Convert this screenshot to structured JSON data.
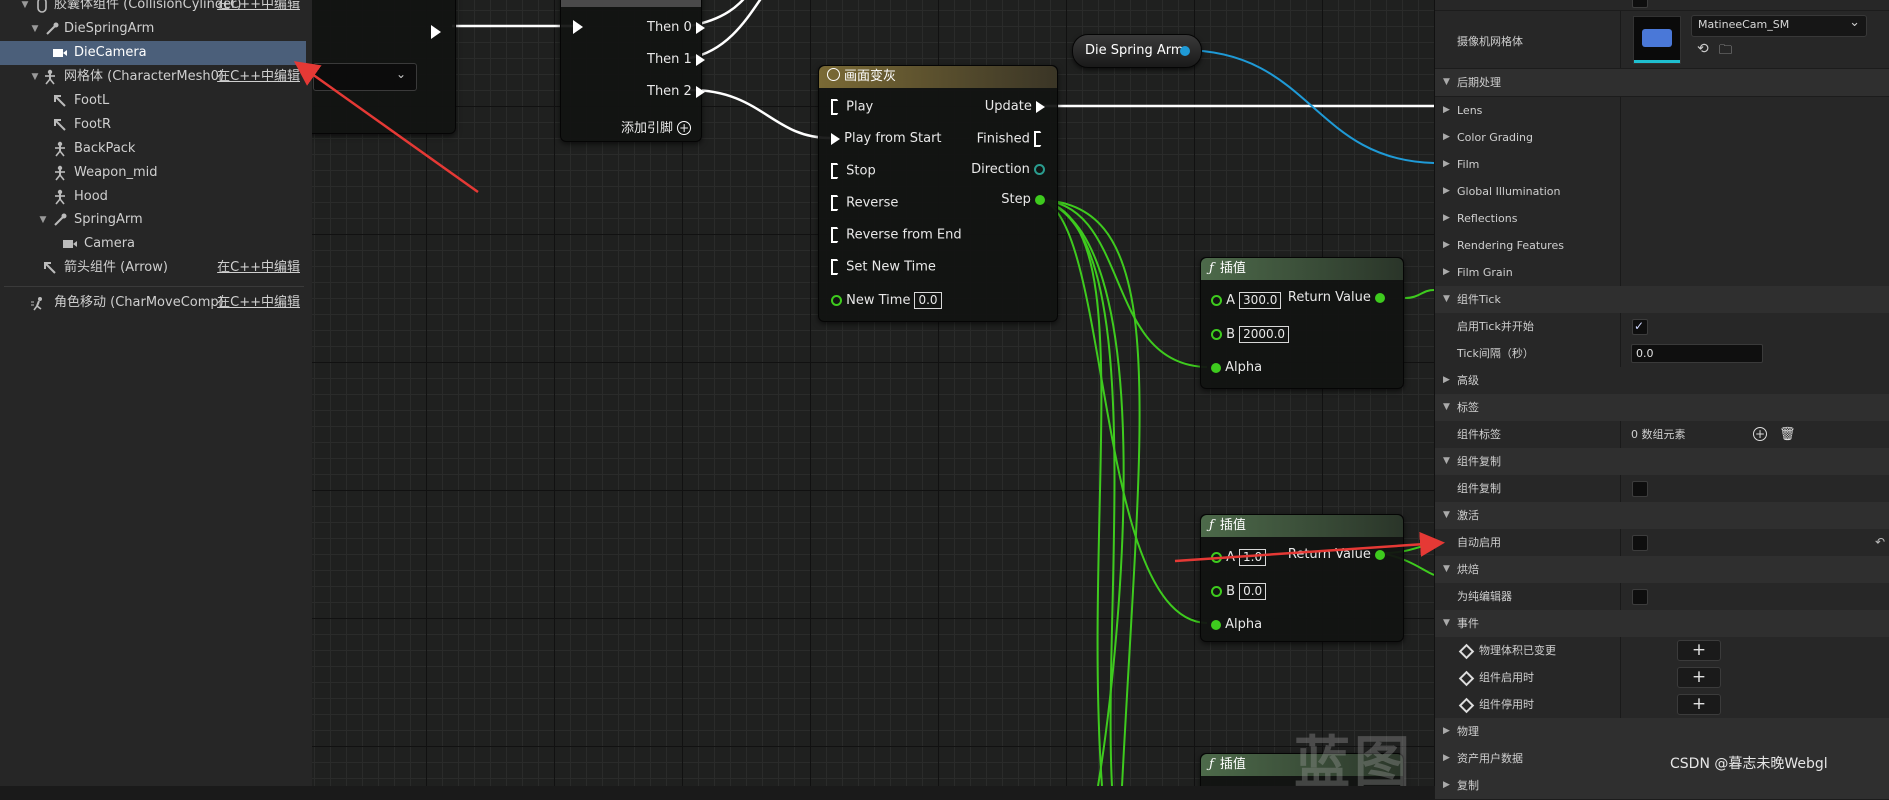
{
  "components": {
    "items": [
      {
        "label": "胶囊体组件 (CollisionCylinder)",
        "edit": "在C++中编辑"
      },
      {
        "label": "DieSpringArm"
      },
      {
        "label": "DieCamera"
      },
      {
        "label": "网格体 (CharacterMesh0)",
        "edit": "在C++中编辑"
      },
      {
        "label": "FootL"
      },
      {
        "label": "FootR"
      },
      {
        "label": "BackPack"
      },
      {
        "label": "Weapon_mid"
      },
      {
        "label": "Hood"
      },
      {
        "label": "SpringArm"
      },
      {
        "label": "Camera"
      },
      {
        "label": "箭头组件 (Arrow)",
        "edit": "在C++中编辑"
      },
      {
        "label": "角色移动 (CharMoveComp)",
        "edit": "在C++中编辑"
      }
    ]
  },
  "graph": {
    "sequence_node": {
      "pins": [
        "Then 0",
        "Then 1",
        "Then 2"
      ],
      "add_pin": "添加引脚"
    },
    "timeline_node": {
      "title": "画面变灰",
      "inputs": [
        "Play",
        "Play from Start",
        "Stop",
        "Reverse",
        "Reverse from End",
        "Set New Time"
      ],
      "new_time_label": "New Time",
      "new_time_value": "0.0",
      "outputs": [
        "Update",
        "Finished",
        "Direction",
        "Step"
      ]
    },
    "spring_arm_var": {
      "label": "Die Spring Arm"
    },
    "lerp1": {
      "title": "插值",
      "a_label": "A",
      "a_value": "300.0",
      "b_label": "B",
      "b_value": "2000.0",
      "alpha_label": "Alpha",
      "return_label": "Return Value"
    },
    "lerp2": {
      "title": "插值",
      "a_label": "A",
      "a_value": "1.0",
      "b_label": "B",
      "b_value": "0.0",
      "alpha_label": "Alpha",
      "return_label": "Return Value"
    },
    "lerp3": {
      "title": "插值"
    },
    "watermark": "蓝图"
  },
  "details": {
    "camera_mesh_label": "摄像机网格体",
    "camera_mesh_value": "MatineeCam_SM",
    "rows": [
      {
        "label": "后期处理"
      },
      {
        "label": "Lens"
      },
      {
        "label": "Color Grading"
      },
      {
        "label": "Film"
      },
      {
        "label": "Global Illumination"
      },
      {
        "label": "Reflections"
      },
      {
        "label": "Rendering Features"
      },
      {
        "label": "Film Grain"
      },
      {
        "label": "组件Tick"
      },
      {
        "label": "启用Tick并开始"
      },
      {
        "label": "Tick间隔（秒）",
        "value": "0.0"
      },
      {
        "label": "高级"
      },
      {
        "label": "标签"
      },
      {
        "label": "组件标签",
        "value": "0 数组元素"
      },
      {
        "label": "组件复制"
      },
      {
        "label": "组件复制"
      },
      {
        "label": "激活"
      },
      {
        "label": "自动启用"
      },
      {
        "label": "烘焙"
      },
      {
        "label": "为纯编辑器"
      },
      {
        "label": "事件"
      },
      {
        "label": "物理体积已变更"
      },
      {
        "label": "组件启用时"
      },
      {
        "label": "组件停用时"
      },
      {
        "label": "物理"
      },
      {
        "label": "资产用户数据"
      },
      {
        "label": "复制"
      }
    ],
    "plus_symbol": "+"
  },
  "footer_watermark": "CSDN @暮志未晚Webgl",
  "colors": {
    "selected": "#4b5f7a",
    "timeline_header": "#7a6a35",
    "lerp_header": "#4d6a4a",
    "float_pin": "#3ecb1e",
    "object_pin": "#1f9ad6",
    "arrow": "#e53935"
  }
}
